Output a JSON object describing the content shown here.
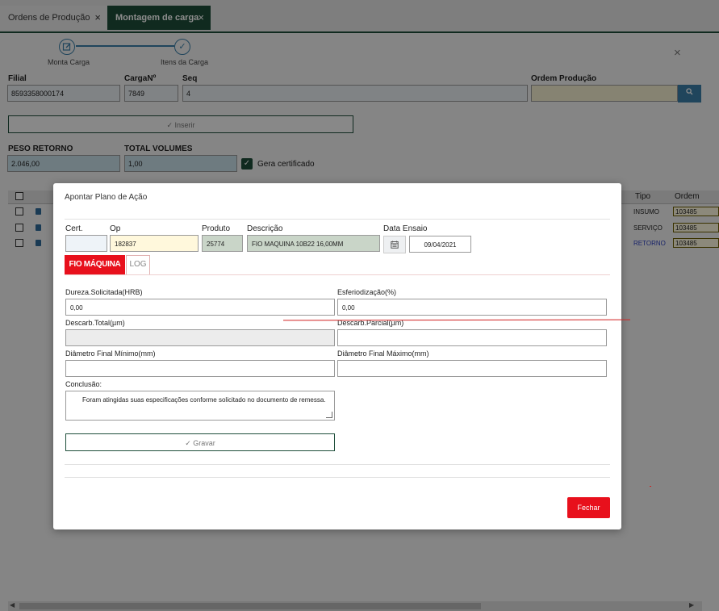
{
  "tabs": [
    {
      "label": "Ordens de Produção",
      "close": "×"
    },
    {
      "label": "Montagem de carga",
      "close": "×"
    }
  ],
  "stepper": {
    "steps": [
      {
        "label": "Monta Carga",
        "icon": "edit-icon"
      },
      {
        "label": "Itens da Carga",
        "icon": "check-icon"
      }
    ],
    "close": "×"
  },
  "form": {
    "filial_label": "Filial",
    "filial_value": "8593358000174",
    "carga_label": "CargaNº",
    "carga_value": "7849",
    "seq_label": "Seq",
    "seq_value": "4",
    "ordem_label": "Ordem Produção",
    "ordem_value": "",
    "inserir_label": "✓ Inserir",
    "peso_label": "PESO RETORNO",
    "peso_value": "2.046,00",
    "volumes_label": "TOTAL VOLUMES",
    "volumes_value": "1,00",
    "gera_label": "Gera certificado"
  },
  "grid": {
    "tipo_header": "Tipo",
    "ordem_header": "Ordem",
    "rows": [
      {
        "tipo": "INSUMO",
        "ordem": "103485"
      },
      {
        "tipo": "SERVIÇO",
        "ordem": "103485"
      },
      {
        "tipo": "RETORNO",
        "ordem": "103485"
      }
    ]
  },
  "modal": {
    "title": "Apontar Plano de Ação",
    "cert_label": "Cert.",
    "cert_value": "",
    "op_label": "Op",
    "op_value": "182837",
    "produto_label": "Produto",
    "produto_value": "25774",
    "descricao_label": "Descrição",
    "descricao_value": "FIO MAQUINA 10B22 16,00MM",
    "data_label": "Data Ensaio",
    "data_value": "09/04/2021",
    "tab_fio": "FIO MÁQUINA",
    "tab_log": "LOG",
    "dureza_label": "Dureza.Solicitada(HRB)",
    "dureza_value": "0,00",
    "esfero_label": "Esferiodização(%)",
    "esfero_value": "0,00",
    "descarb_total_label": "Descarb.Total(µm)",
    "descarb_total_value": "",
    "descarb_parcial_label": "Descarb.Parcial(µm)",
    "descarb_parcial_value": "",
    "diam_min_label": "Diâmetro Final Mínimo(mm)",
    "diam_min_value": "",
    "diam_max_label": "Diâmetro Final Máximo(mm)",
    "diam_max_value": "",
    "conclusao_label": "Conclusão:",
    "conclusao_value": "Foram atingidas suas especificações conforme solicitado no documento de remessa.",
    "gravar_label": "✓ Gravar",
    "fechar_label": "Fechar"
  },
  "colors": {
    "brand_green": "#1e4e3a",
    "accent_blue": "#3b7fa8",
    "danger_red": "#e8101c"
  }
}
